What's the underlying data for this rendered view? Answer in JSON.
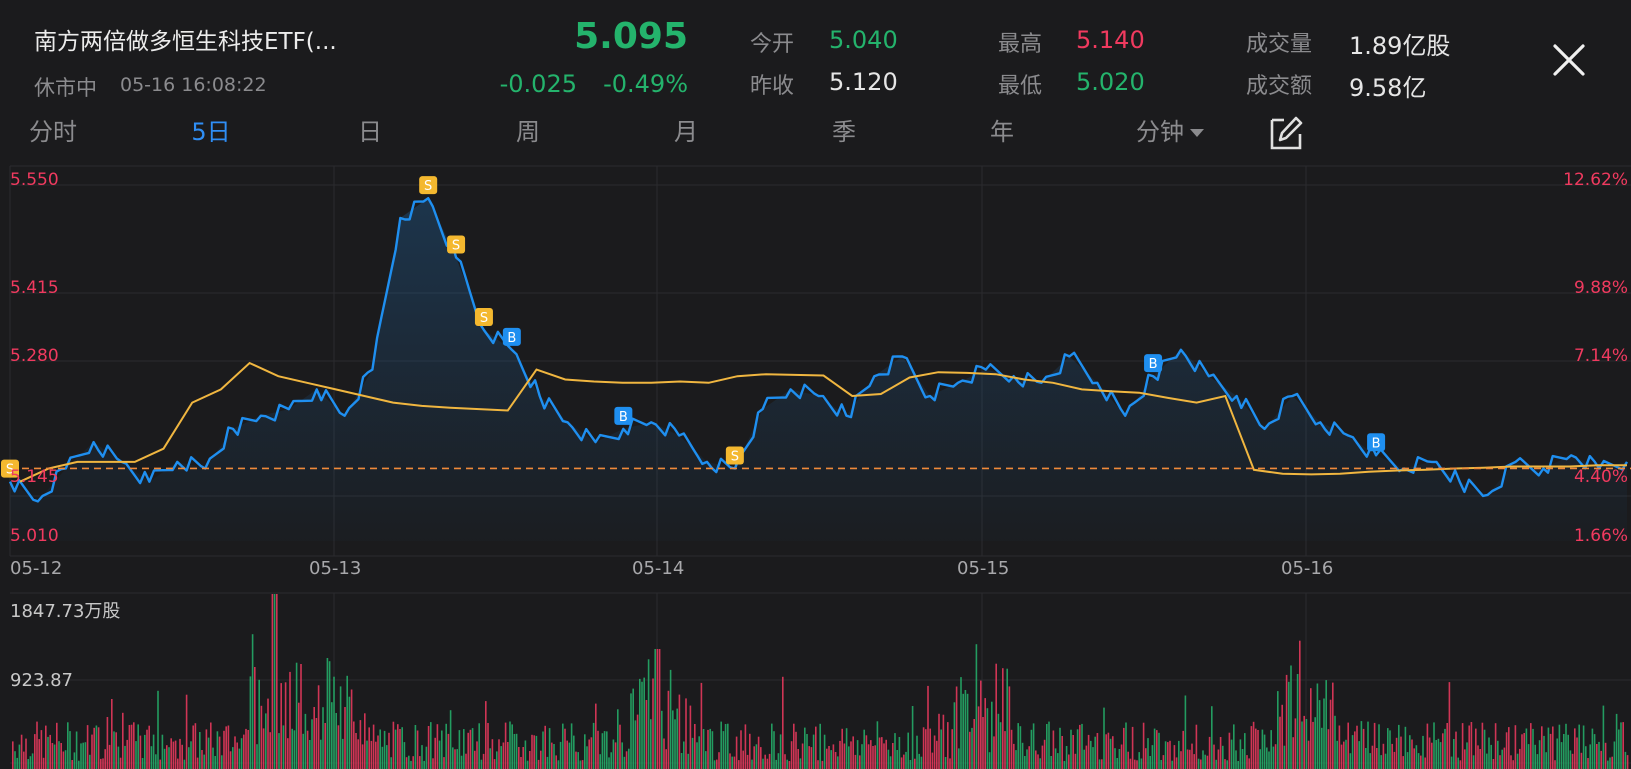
{
  "header": {
    "title": "南方两倍做多恒生科技ETF(...",
    "status": "休市中",
    "datetime": "05-16 16:08:22",
    "price": "5.095",
    "change_abs": "-0.025",
    "change_pct": "-0.49%"
  },
  "stats": {
    "open_label": "今开",
    "open_value": "5.040",
    "prev_close_label": "昨收",
    "prev_close_value": "5.120",
    "high_label": "最高",
    "high_value": "5.140",
    "low_label": "最低",
    "low_value": "5.020",
    "volume_label": "成交量",
    "volume_value": "1.89亿股",
    "turnover_label": "成交额",
    "turnover_value": "9.58亿"
  },
  "tabs": [
    {
      "label": "分时"
    },
    {
      "label": "5日"
    },
    {
      "label": "日"
    },
    {
      "label": "周"
    },
    {
      "label": "月"
    },
    {
      "label": "季"
    },
    {
      "label": "年"
    },
    {
      "label": "分钟"
    }
  ],
  "active_tab": "5日",
  "icons": {
    "close": "close-icon",
    "draw": "draw-tool-icon",
    "dropdown": "chevron-down-icon"
  },
  "colors": {
    "up": "#f03a5f",
    "down": "#24b36c",
    "price_line": "#1f8ff0",
    "avg_line": "#f0b640",
    "prev_close_line": "#f08a3a",
    "active_tab": "#2f8ef5",
    "sell_marker": "#f4b82f",
    "buy_marker": "#1f8ff0"
  },
  "chart_data": {
    "type": "line",
    "x_labels": [
      "05-12",
      "05-13",
      "05-14",
      "05-15",
      "05-16"
    ],
    "y_labels_left": [
      "5.550",
      "5.415",
      "5.280",
      "5.145",
      "5.010"
    ],
    "y_labels_right": [
      "12.62%",
      "9.88%",
      "7.14%",
      "4.40%",
      "1.66%"
    ],
    "ylim": [
      5.01,
      5.55
    ],
    "prev_close": 5.12,
    "series": [
      {
        "values": [
          5.1,
          5.07,
          5.12,
          5.16,
          5.13,
          5.1,
          5.13,
          5.12,
          5.18,
          5.2,
          5.21,
          5.24,
          5.2,
          5.27,
          5.5,
          5.53,
          5.44,
          5.33,
          5.3,
          5.23,
          5.19,
          5.16,
          5.18,
          5.19,
          5.17,
          5.13,
          5.12,
          5.21,
          5.24,
          5.23,
          5.2,
          5.26,
          5.29,
          5.23,
          5.25,
          5.27,
          5.26,
          5.25,
          5.29,
          5.25,
          5.2,
          5.26,
          5.3,
          5.26,
          5.23,
          5.18,
          5.23,
          5.19,
          5.17,
          5.14,
          5.12,
          5.13,
          5.1,
          5.08,
          5.13,
          5.12,
          5.14,
          5.12,
          5.13
        ]
      },
      {
        "values": [
          5.1,
          5.12,
          5.13,
          5.13,
          5.13,
          5.15,
          5.22,
          5.24,
          5.28,
          5.26,
          5.25,
          5.24,
          5.23,
          5.22,
          5.215,
          5.212,
          5.21,
          5.208,
          5.27,
          5.255,
          5.252,
          5.25,
          5.25,
          5.252,
          5.25,
          5.26,
          5.263,
          5.262,
          5.261,
          5.23,
          5.233,
          5.258,
          5.266,
          5.265,
          5.263,
          5.255,
          5.25,
          5.24,
          5.237,
          5.235,
          5.227,
          5.22,
          5.23,
          5.118,
          5.112,
          5.111,
          5.112,
          5.115,
          5.117,
          5.118,
          5.12,
          5.121,
          5.123,
          5.123,
          5.123,
          5.125,
          5.125
        ]
      }
    ],
    "markers": [
      {
        "type": "S",
        "x_index": 0
      },
      {
        "type": "S",
        "x_index": 15
      },
      {
        "type": "S",
        "x_index": 16
      },
      {
        "type": "S",
        "x_index": 17
      },
      {
        "type": "B",
        "x_index": 18
      },
      {
        "type": "B",
        "x_index": 22
      },
      {
        "type": "S",
        "x_index": 26
      },
      {
        "type": "B",
        "x_index": 41
      },
      {
        "type": "B",
        "x_index": 49
      }
    ],
    "volume": {
      "y_labels": [
        "1847.73万股",
        "923.87"
      ],
      "max": 1847.73
    }
  }
}
